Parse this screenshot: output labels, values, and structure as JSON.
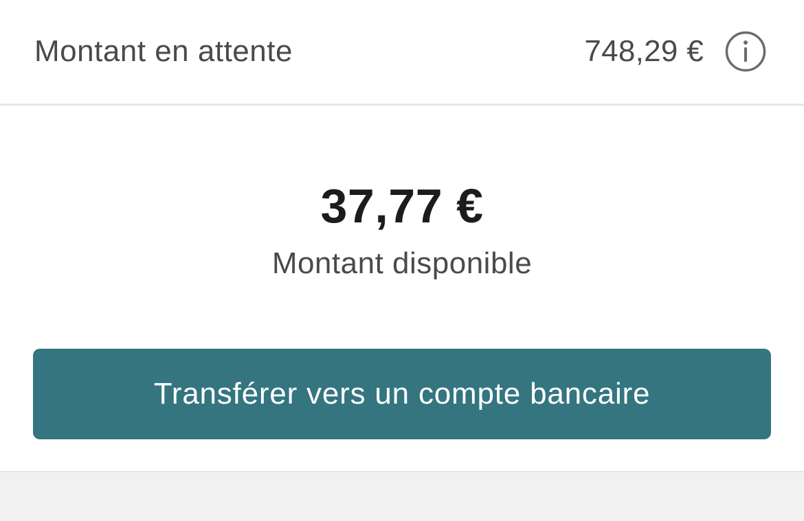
{
  "pending": {
    "label": "Montant en attente",
    "amount": "748,29 €",
    "info_icon": "info-circle-icon"
  },
  "available": {
    "amount": "37,77 €",
    "label": "Montant disponible"
  },
  "transfer": {
    "button_label": "Transférer vers un compte bancaire"
  },
  "colors": {
    "accent": "#347580",
    "text_primary": "#1c1c1c",
    "text_secondary": "#4a4a4a",
    "background": "#ffffff",
    "footer_background": "#f1f1f1",
    "divider": "#e6e6e6"
  }
}
